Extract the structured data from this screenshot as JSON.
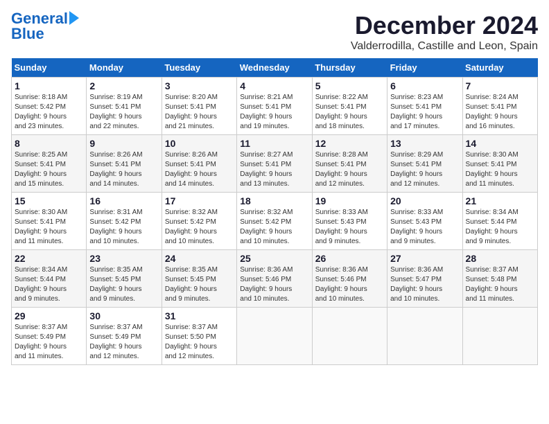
{
  "logo": {
    "line1": "General",
    "line2": "Blue"
  },
  "title": "December 2024",
  "subtitle": "Valderrodilla, Castille and Leon, Spain",
  "weekdays": [
    "Sunday",
    "Monday",
    "Tuesday",
    "Wednesday",
    "Thursday",
    "Friday",
    "Saturday"
  ],
  "weeks": [
    [
      {
        "day": "1",
        "info": "Sunrise: 8:18 AM\nSunset: 5:42 PM\nDaylight: 9 hours\nand 23 minutes."
      },
      {
        "day": "2",
        "info": "Sunrise: 8:19 AM\nSunset: 5:41 PM\nDaylight: 9 hours\nand 22 minutes."
      },
      {
        "day": "3",
        "info": "Sunrise: 8:20 AM\nSunset: 5:41 PM\nDaylight: 9 hours\nand 21 minutes."
      },
      {
        "day": "4",
        "info": "Sunrise: 8:21 AM\nSunset: 5:41 PM\nDaylight: 9 hours\nand 19 minutes."
      },
      {
        "day": "5",
        "info": "Sunrise: 8:22 AM\nSunset: 5:41 PM\nDaylight: 9 hours\nand 18 minutes."
      },
      {
        "day": "6",
        "info": "Sunrise: 8:23 AM\nSunset: 5:41 PM\nDaylight: 9 hours\nand 17 minutes."
      },
      {
        "day": "7",
        "info": "Sunrise: 8:24 AM\nSunset: 5:41 PM\nDaylight: 9 hours\nand 16 minutes."
      }
    ],
    [
      {
        "day": "8",
        "info": "Sunrise: 8:25 AM\nSunset: 5:41 PM\nDaylight: 9 hours\nand 15 minutes."
      },
      {
        "day": "9",
        "info": "Sunrise: 8:26 AM\nSunset: 5:41 PM\nDaylight: 9 hours\nand 14 minutes."
      },
      {
        "day": "10",
        "info": "Sunrise: 8:26 AM\nSunset: 5:41 PM\nDaylight: 9 hours\nand 14 minutes."
      },
      {
        "day": "11",
        "info": "Sunrise: 8:27 AM\nSunset: 5:41 PM\nDaylight: 9 hours\nand 13 minutes."
      },
      {
        "day": "12",
        "info": "Sunrise: 8:28 AM\nSunset: 5:41 PM\nDaylight: 9 hours\nand 12 minutes."
      },
      {
        "day": "13",
        "info": "Sunrise: 8:29 AM\nSunset: 5:41 PM\nDaylight: 9 hours\nand 12 minutes."
      },
      {
        "day": "14",
        "info": "Sunrise: 8:30 AM\nSunset: 5:41 PM\nDaylight: 9 hours\nand 11 minutes."
      }
    ],
    [
      {
        "day": "15",
        "info": "Sunrise: 8:30 AM\nSunset: 5:41 PM\nDaylight: 9 hours\nand 11 minutes."
      },
      {
        "day": "16",
        "info": "Sunrise: 8:31 AM\nSunset: 5:42 PM\nDaylight: 9 hours\nand 10 minutes."
      },
      {
        "day": "17",
        "info": "Sunrise: 8:32 AM\nSunset: 5:42 PM\nDaylight: 9 hours\nand 10 minutes."
      },
      {
        "day": "18",
        "info": "Sunrise: 8:32 AM\nSunset: 5:42 PM\nDaylight: 9 hours\nand 10 minutes."
      },
      {
        "day": "19",
        "info": "Sunrise: 8:33 AM\nSunset: 5:43 PM\nDaylight: 9 hours\nand 9 minutes."
      },
      {
        "day": "20",
        "info": "Sunrise: 8:33 AM\nSunset: 5:43 PM\nDaylight: 9 hours\nand 9 minutes."
      },
      {
        "day": "21",
        "info": "Sunrise: 8:34 AM\nSunset: 5:44 PM\nDaylight: 9 hours\nand 9 minutes."
      }
    ],
    [
      {
        "day": "22",
        "info": "Sunrise: 8:34 AM\nSunset: 5:44 PM\nDaylight: 9 hours\nand 9 minutes."
      },
      {
        "day": "23",
        "info": "Sunrise: 8:35 AM\nSunset: 5:45 PM\nDaylight: 9 hours\nand 9 minutes."
      },
      {
        "day": "24",
        "info": "Sunrise: 8:35 AM\nSunset: 5:45 PM\nDaylight: 9 hours\nand 9 minutes."
      },
      {
        "day": "25",
        "info": "Sunrise: 8:36 AM\nSunset: 5:46 PM\nDaylight: 9 hours\nand 10 minutes."
      },
      {
        "day": "26",
        "info": "Sunrise: 8:36 AM\nSunset: 5:46 PM\nDaylight: 9 hours\nand 10 minutes."
      },
      {
        "day": "27",
        "info": "Sunrise: 8:36 AM\nSunset: 5:47 PM\nDaylight: 9 hours\nand 10 minutes."
      },
      {
        "day": "28",
        "info": "Sunrise: 8:37 AM\nSunset: 5:48 PM\nDaylight: 9 hours\nand 11 minutes."
      }
    ],
    [
      {
        "day": "29",
        "info": "Sunrise: 8:37 AM\nSunset: 5:49 PM\nDaylight: 9 hours\nand 11 minutes."
      },
      {
        "day": "30",
        "info": "Sunrise: 8:37 AM\nSunset: 5:49 PM\nDaylight: 9 hours\nand 12 minutes."
      },
      {
        "day": "31",
        "info": "Sunrise: 8:37 AM\nSunset: 5:50 PM\nDaylight: 9 hours\nand 12 minutes."
      },
      null,
      null,
      null,
      null
    ]
  ]
}
